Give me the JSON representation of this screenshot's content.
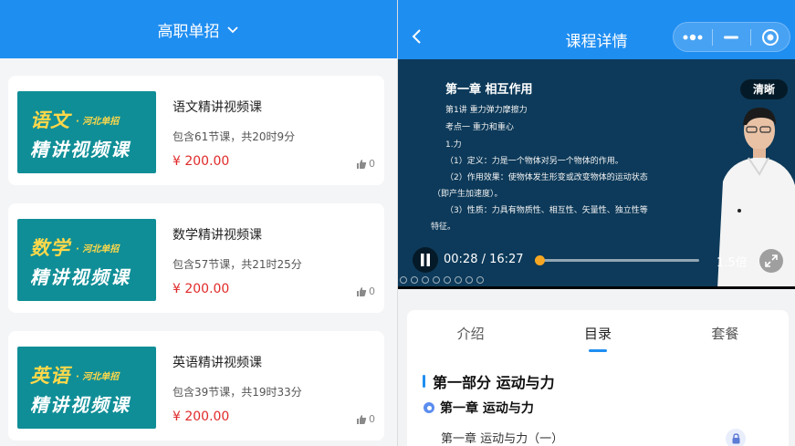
{
  "left": {
    "header": {
      "title": "高职单招"
    },
    "courses": [
      {
        "thumb_big": "语文",
        "thumb_small": "· 河北单招",
        "thumb_line2": "精讲视频课",
        "title": "语文精讲视频课",
        "meta": "包含61节课，共20时9分",
        "price": "¥ 200.00",
        "likes": "0"
      },
      {
        "thumb_big": "数学",
        "thumb_small": "· 河北单招",
        "thumb_line2": "精讲视频课",
        "title": "数学精讲视频课",
        "meta": "包含57节课，共21时25分",
        "price": "¥ 200.00",
        "likes": "0"
      },
      {
        "thumb_big": "英语",
        "thumb_small": "· 河北单招",
        "thumb_line2": "精讲视频课",
        "title": "英语精讲视频课",
        "meta": "包含39节课，共19时33分",
        "price": "¥ 200.00",
        "likes": "0"
      }
    ]
  },
  "right": {
    "header": {
      "title": "课程详情"
    },
    "video": {
      "slide_title": "第一章   相互作用",
      "slide_lines": [
        "第1讲   重力弹力摩擦力",
        "考点一   重力和重心",
        "1.力",
        "（1）定义：力是一个物体对另一个物体的作用。",
        "（2）作用效果：使物体发生形变或改变物体的运动状态",
        "（即产生加速度）。",
        "（3）性质：力具有物质性、相互性、矢量性、独立性等",
        "特征。"
      ],
      "quality": "清晰",
      "time": "00:28 / 16:27",
      "progress": 0.03,
      "speed": "1.5倍"
    },
    "tabs": [
      "介绍",
      "目录",
      "套餐"
    ],
    "active_tab": "目录",
    "catalog": {
      "part": "第一部分 运动与力",
      "chapter": "第一章 运动与力",
      "lesson": "第一章 运动与力（一）"
    }
  },
  "colors": {
    "primary": "#1f8ef1",
    "price": "#e02a2a",
    "thumb_bg": "#0f8e97",
    "thumb_accent": "#ffd84a",
    "progress": "#f5a623"
  }
}
